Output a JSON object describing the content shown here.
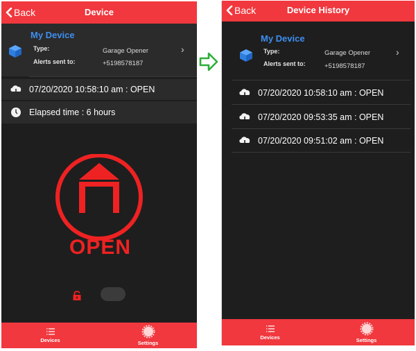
{
  "left_screen": {
    "back_label": "Back",
    "title": "Device",
    "device": {
      "name": "My Device",
      "type_label": "Type:",
      "type_value": "Garage Opener",
      "alerts_label": "Alerts sent to:",
      "alerts_value": "+5198578187"
    },
    "last_event": "07/20/2020 10:58:10 am : OPEN",
    "elapsed": "Elapsed time : 6 hours",
    "status_text": "OPEN",
    "tabs": [
      {
        "label": "Devices",
        "icon": "list-icon"
      },
      {
        "label": "Settings",
        "icon": "gear-icon"
      }
    ]
  },
  "right_screen": {
    "back_label": "Back",
    "title": "Device History",
    "device": {
      "name": "My Device",
      "type_label": "Type:",
      "type_value": "Garage Opener",
      "alerts_label": "Alerts sent to:",
      "alerts_value": "+5198578187"
    },
    "history": [
      "07/20/2020 10:58:10 am : OPEN",
      "07/20/2020 09:53:35 am : OPEN",
      "07/20/2020 09:51:02 am : OPEN"
    ],
    "tabs": [
      {
        "label": "Devices",
        "icon": "list-icon"
      },
      {
        "label": "Settings",
        "icon": "gear-icon"
      }
    ]
  },
  "colors": {
    "accent": "#f0383e",
    "device_name": "#3d8ef0",
    "background": "#1e1e1e",
    "status_red": "#ee2222",
    "transition_arrow": "#2eae3a"
  }
}
